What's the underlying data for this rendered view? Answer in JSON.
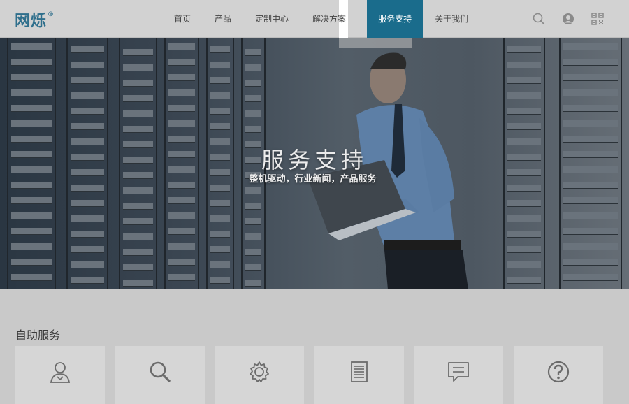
{
  "header": {
    "logo_text": "网烁",
    "logo_mark": "®",
    "nav": [
      {
        "label": "首页"
      },
      {
        "label": "产品"
      },
      {
        "label": "定制中心"
      },
      {
        "label": "解决方案"
      },
      {
        "label": "服务支持",
        "active": true
      },
      {
        "label": "关于我们"
      }
    ],
    "icons": [
      "search-icon",
      "user-icon",
      "qrcode-icon"
    ]
  },
  "hero": {
    "title": "服务支持",
    "subtitle": "整机驱动，行业新闻，产品服务"
  },
  "self_service": {
    "title": "自助服务",
    "cards": [
      {
        "icon": "person-icon"
      },
      {
        "icon": "search-icon"
      },
      {
        "icon": "gear-icon"
      },
      {
        "icon": "document-icon"
      },
      {
        "icon": "message-icon"
      },
      {
        "icon": "question-icon"
      }
    ]
  },
  "colors": {
    "accent": "#1a6c8c",
    "logo": "#2f6f8c",
    "header_bg": "#d2d2d2",
    "page_bg": "#c9c9c9"
  }
}
